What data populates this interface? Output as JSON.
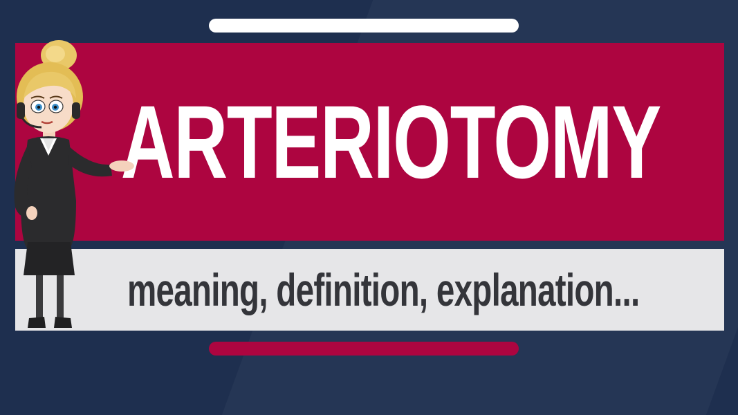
{
  "colors": {
    "background": "#1e2f4f",
    "accent": "#ad0540",
    "light_banner": "#e6e6e8",
    "pill_light": "#ffffff",
    "pill_accent": "#ad0540",
    "title_text": "#ffffff",
    "subtitle_text": "#34353a"
  },
  "title": "ARTERIOTOMY",
  "subtitle": "meaning, definition, explanation...",
  "presenter": {
    "icon": "cartoon-woman-with-headset-icon"
  }
}
